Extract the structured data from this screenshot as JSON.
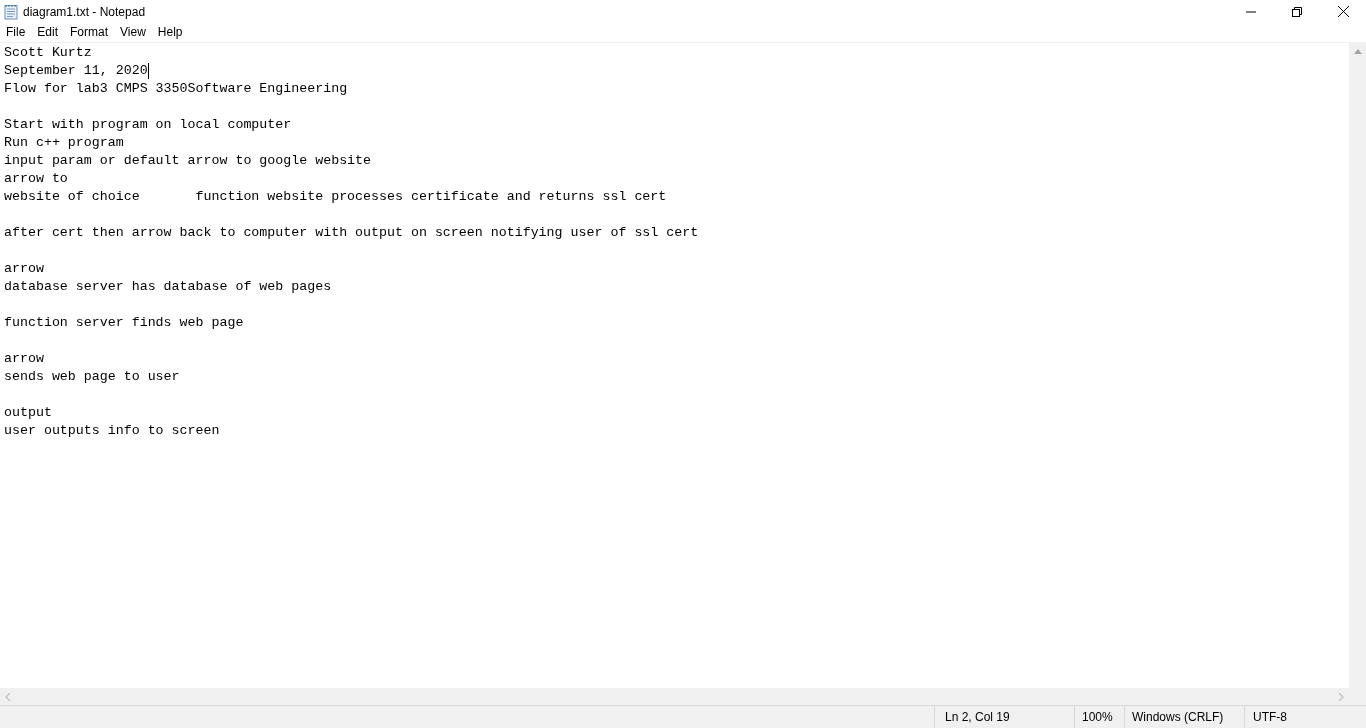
{
  "window": {
    "title": "diagram1.txt - Notepad"
  },
  "menu": [
    "File",
    "Edit",
    "Format",
    "View",
    "Help"
  ],
  "lines": [
    {
      "kind": "text",
      "text": "Scott Kurtz",
      "caret": false
    },
    {
      "kind": "text",
      "text": "September 11, 2020",
      "caret": true
    },
    {
      "kind": "text",
      "text": "Flow for lab3 CMPS 3350Software Engineering",
      "caret": false
    },
    {
      "kind": "blank"
    },
    {
      "kind": "text",
      "text": "Start with program on local computer",
      "caret": false
    },
    {
      "kind": "text",
      "text": "Run c++ program",
      "caret": false
    },
    {
      "kind": "text",
      "text": "input param or default arrow to google website",
      "caret": false
    },
    {
      "kind": "text",
      "text": "arrow to",
      "caret": false
    },
    {
      "kind": "text",
      "text": "website of choice       function website processes certificate and returns ssl cert",
      "caret": false
    },
    {
      "kind": "blank"
    },
    {
      "kind": "text",
      "text": "after cert then arrow back to computer with output on screen notifying user of ssl cert",
      "caret": false
    },
    {
      "kind": "blank"
    },
    {
      "kind": "text",
      "text": "arrow",
      "caret": false
    },
    {
      "kind": "text",
      "text": "database server has database of web pages",
      "caret": false
    },
    {
      "kind": "blank"
    },
    {
      "kind": "text",
      "text": "function server finds web page",
      "caret": false
    },
    {
      "kind": "blank"
    },
    {
      "kind": "text",
      "text": "arrow",
      "caret": false
    },
    {
      "kind": "text",
      "text": "sends web page to user",
      "caret": false
    },
    {
      "kind": "blank"
    },
    {
      "kind": "text",
      "text": "output",
      "caret": false
    },
    {
      "kind": "text",
      "text": "user outputs info to screen",
      "caret": false
    }
  ],
  "status_bar": {
    "position": "Ln 2, Col 19",
    "zoom": "100%",
    "line_endings": "Windows (CRLF)",
    "encoding": "UTF-8"
  }
}
